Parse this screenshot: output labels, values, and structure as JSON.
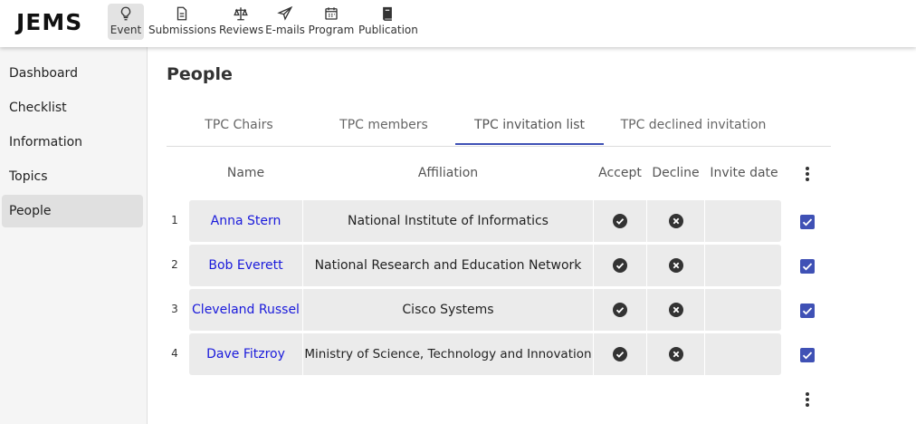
{
  "app": {
    "logo": "JEMS"
  },
  "topnav": [
    {
      "label": "Event",
      "icon": "lightbulb-icon",
      "active": true
    },
    {
      "label": "Submissions",
      "icon": "document-icon",
      "active": false
    },
    {
      "label": "Reviews",
      "icon": "scales-icon",
      "active": false
    },
    {
      "label": "E-mails",
      "icon": "paper-plane-icon",
      "active": false
    },
    {
      "label": "Program",
      "icon": "calendar-icon",
      "active": false
    },
    {
      "label": "Publication",
      "icon": "book-icon",
      "active": false
    }
  ],
  "sidebar": {
    "items": [
      {
        "label": "Dashboard",
        "active": false
      },
      {
        "label": "Checklist",
        "active": false
      },
      {
        "label": "Information",
        "active": false
      },
      {
        "label": "Topics",
        "active": false
      },
      {
        "label": "People",
        "active": true
      }
    ]
  },
  "main": {
    "title": "People",
    "tabs": [
      {
        "label": "TPC Chairs",
        "active": false
      },
      {
        "label": "TPC members",
        "active": false
      },
      {
        "label": "TPC invitation list",
        "active": true
      },
      {
        "label": "TPC declined invitation",
        "active": false
      }
    ],
    "table": {
      "headers": {
        "name": "Name",
        "affiliation": "Affiliation",
        "accept": "Accept",
        "decline": "Decline",
        "invite_date": "Invite date"
      },
      "rows": [
        {
          "num": "1",
          "name": "Anna Stern",
          "affiliation": "National Institute of Informatics",
          "invite_date": "",
          "selected": true
        },
        {
          "num": "2",
          "name": "Bob Everett",
          "affiliation": "National Research and Education Network",
          "invite_date": "",
          "selected": true
        },
        {
          "num": "3",
          "name": "Cleveland Russel",
          "affiliation": "Cisco Systems",
          "invite_date": "",
          "selected": true
        },
        {
          "num": "4",
          "name": "Dave Fitzroy",
          "affiliation": "Ministry of Science, Technology and Innovation",
          "invite_date": "",
          "selected": true
        }
      ]
    }
  },
  "colors": {
    "accent": "#3f51b5",
    "link": "#1a1adb",
    "row_bg": "#ebebeb",
    "sidebar_bg": "#f5f5f5"
  }
}
